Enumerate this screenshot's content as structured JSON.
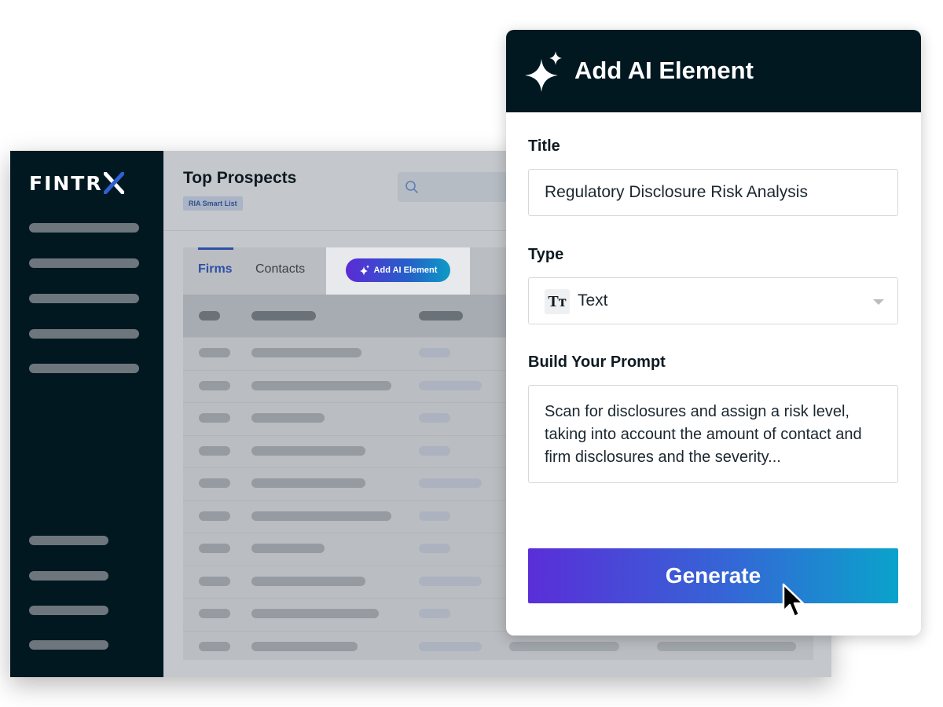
{
  "app": {
    "logo_text": "FINTR",
    "logo_letter": "X",
    "page_title": "Top Prospects",
    "list_badge": "RIA Smart List",
    "tabs": [
      {
        "label": "Firms",
        "active": true
      },
      {
        "label": "Contacts",
        "active": false
      }
    ],
    "ai_chip_label": "Add AI Element",
    "search_icon": "search-icon"
  },
  "dialog": {
    "header_icon": "sparkle-icon",
    "title": "Add AI Element",
    "title_label": "Title",
    "title_value": "Regulatory Disclosure Risk Analysis",
    "type_label": "Type",
    "type_icon_text": "Tт",
    "type_value": "Text",
    "prompt_label": "Build Your Prompt",
    "prompt_value": "Scan for disclosures and assign a risk level, taking into account the amount of contact and firm disclosures and the severity...",
    "generate_label": "Generate"
  },
  "colors": {
    "sidebar": "#011821",
    "accent_blue": "#2d4fa6",
    "gradient_start": "#5a2ed8",
    "gradient_end": "#0aa3cb",
    "logo_x": "#2f5fd0"
  }
}
